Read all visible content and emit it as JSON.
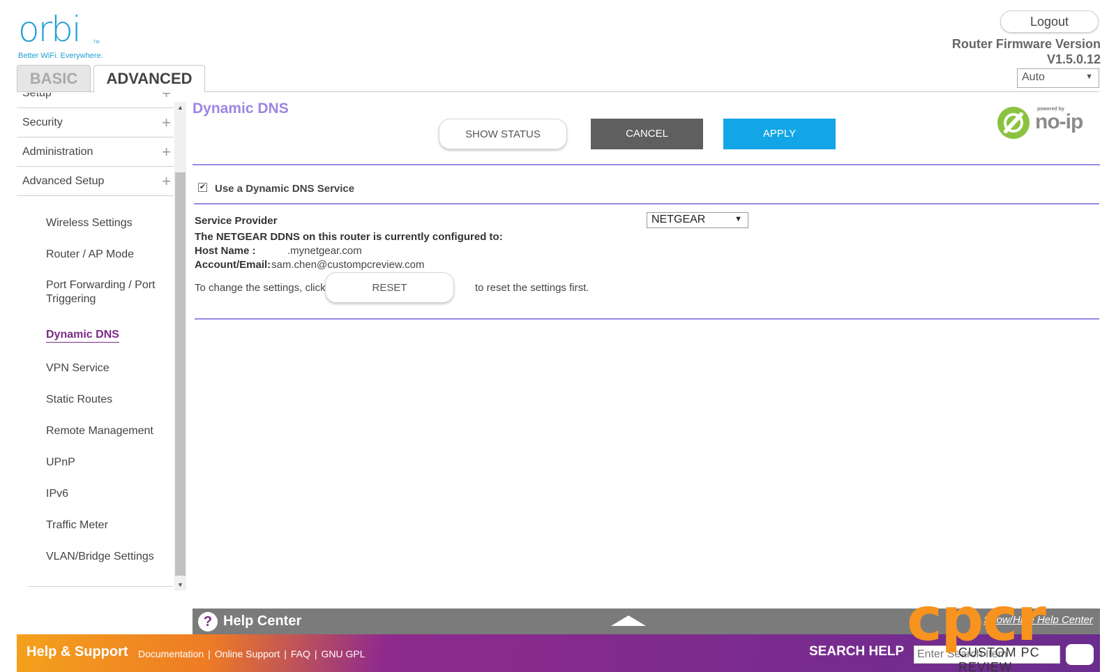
{
  "brand": {
    "logo_text": "orbi",
    "logo_tm": "TM",
    "tagline": "Better WiFi. Everywhere."
  },
  "tabs": [
    {
      "label": "BASIC",
      "active": false
    },
    {
      "label": "ADVANCED",
      "active": true
    }
  ],
  "header": {
    "logout_label": "Logout",
    "firmware_label": "Router Firmware Version",
    "firmware_version": "V1.5.0.12",
    "language_value": "Auto"
  },
  "sidebar": {
    "partial_top": "Setup",
    "sections": [
      {
        "label": "Security"
      },
      {
        "label": "Administration"
      },
      {
        "label": "Advanced Setup"
      }
    ],
    "subitems": [
      {
        "label": "Wireless Settings"
      },
      {
        "label": "Router / AP Mode"
      },
      {
        "label": "Port Forwarding / Port Triggering"
      },
      {
        "label": "Dynamic DNS",
        "active": true
      },
      {
        "label": "VPN Service"
      },
      {
        "label": "Static Routes"
      },
      {
        "label": "Remote Management"
      },
      {
        "label": "UPnP"
      },
      {
        "label": "IPv6"
      },
      {
        "label": "Traffic Meter"
      },
      {
        "label": "VLAN/Bridge Settings"
      }
    ]
  },
  "main": {
    "title": "Dynamic DNS",
    "buttons": {
      "show_status": "SHOW STATUS",
      "cancel": "CANCEL",
      "apply": "APPLY"
    },
    "noip": {
      "powered": "powered by",
      "text": "no-ip"
    },
    "use_ddns_label": "Use a Dynamic DNS Service",
    "use_ddns_checked": true,
    "service_provider_label": "Service Provider",
    "service_provider_value": "NETGEAR",
    "configured_label": "The NETGEAR DDNS on this router is currently configured to:",
    "host_label": "Host Name :",
    "host_value": ".mynetgear.com",
    "account_label": "Account/Email:",
    "account_value": "sam.chen@custompcreview.com",
    "change_prefix": "To change the settings, click",
    "reset_label": "RESET",
    "change_suffix": "to reset the settings first."
  },
  "help_center": {
    "icon": "?",
    "title": "Help Center",
    "show_hide": "Show/Hide Help Center"
  },
  "footer": {
    "title": "Help & Support",
    "links": [
      "Documentation",
      "Online Support",
      "FAQ",
      "GNU GPL"
    ],
    "search_label": "SEARCH HELP",
    "search_placeholder": "Enter Search Item"
  },
  "watermark": {
    "big": "cpcr",
    "small": "CUSTOM PC REVIEW"
  },
  "colors": {
    "brand_blue": "#1fa1d6",
    "title_purple": "#9a87e3",
    "active_purple": "#7a2a86",
    "apply_blue": "#12a6e6",
    "cancel_gray": "#5f5f5f"
  }
}
